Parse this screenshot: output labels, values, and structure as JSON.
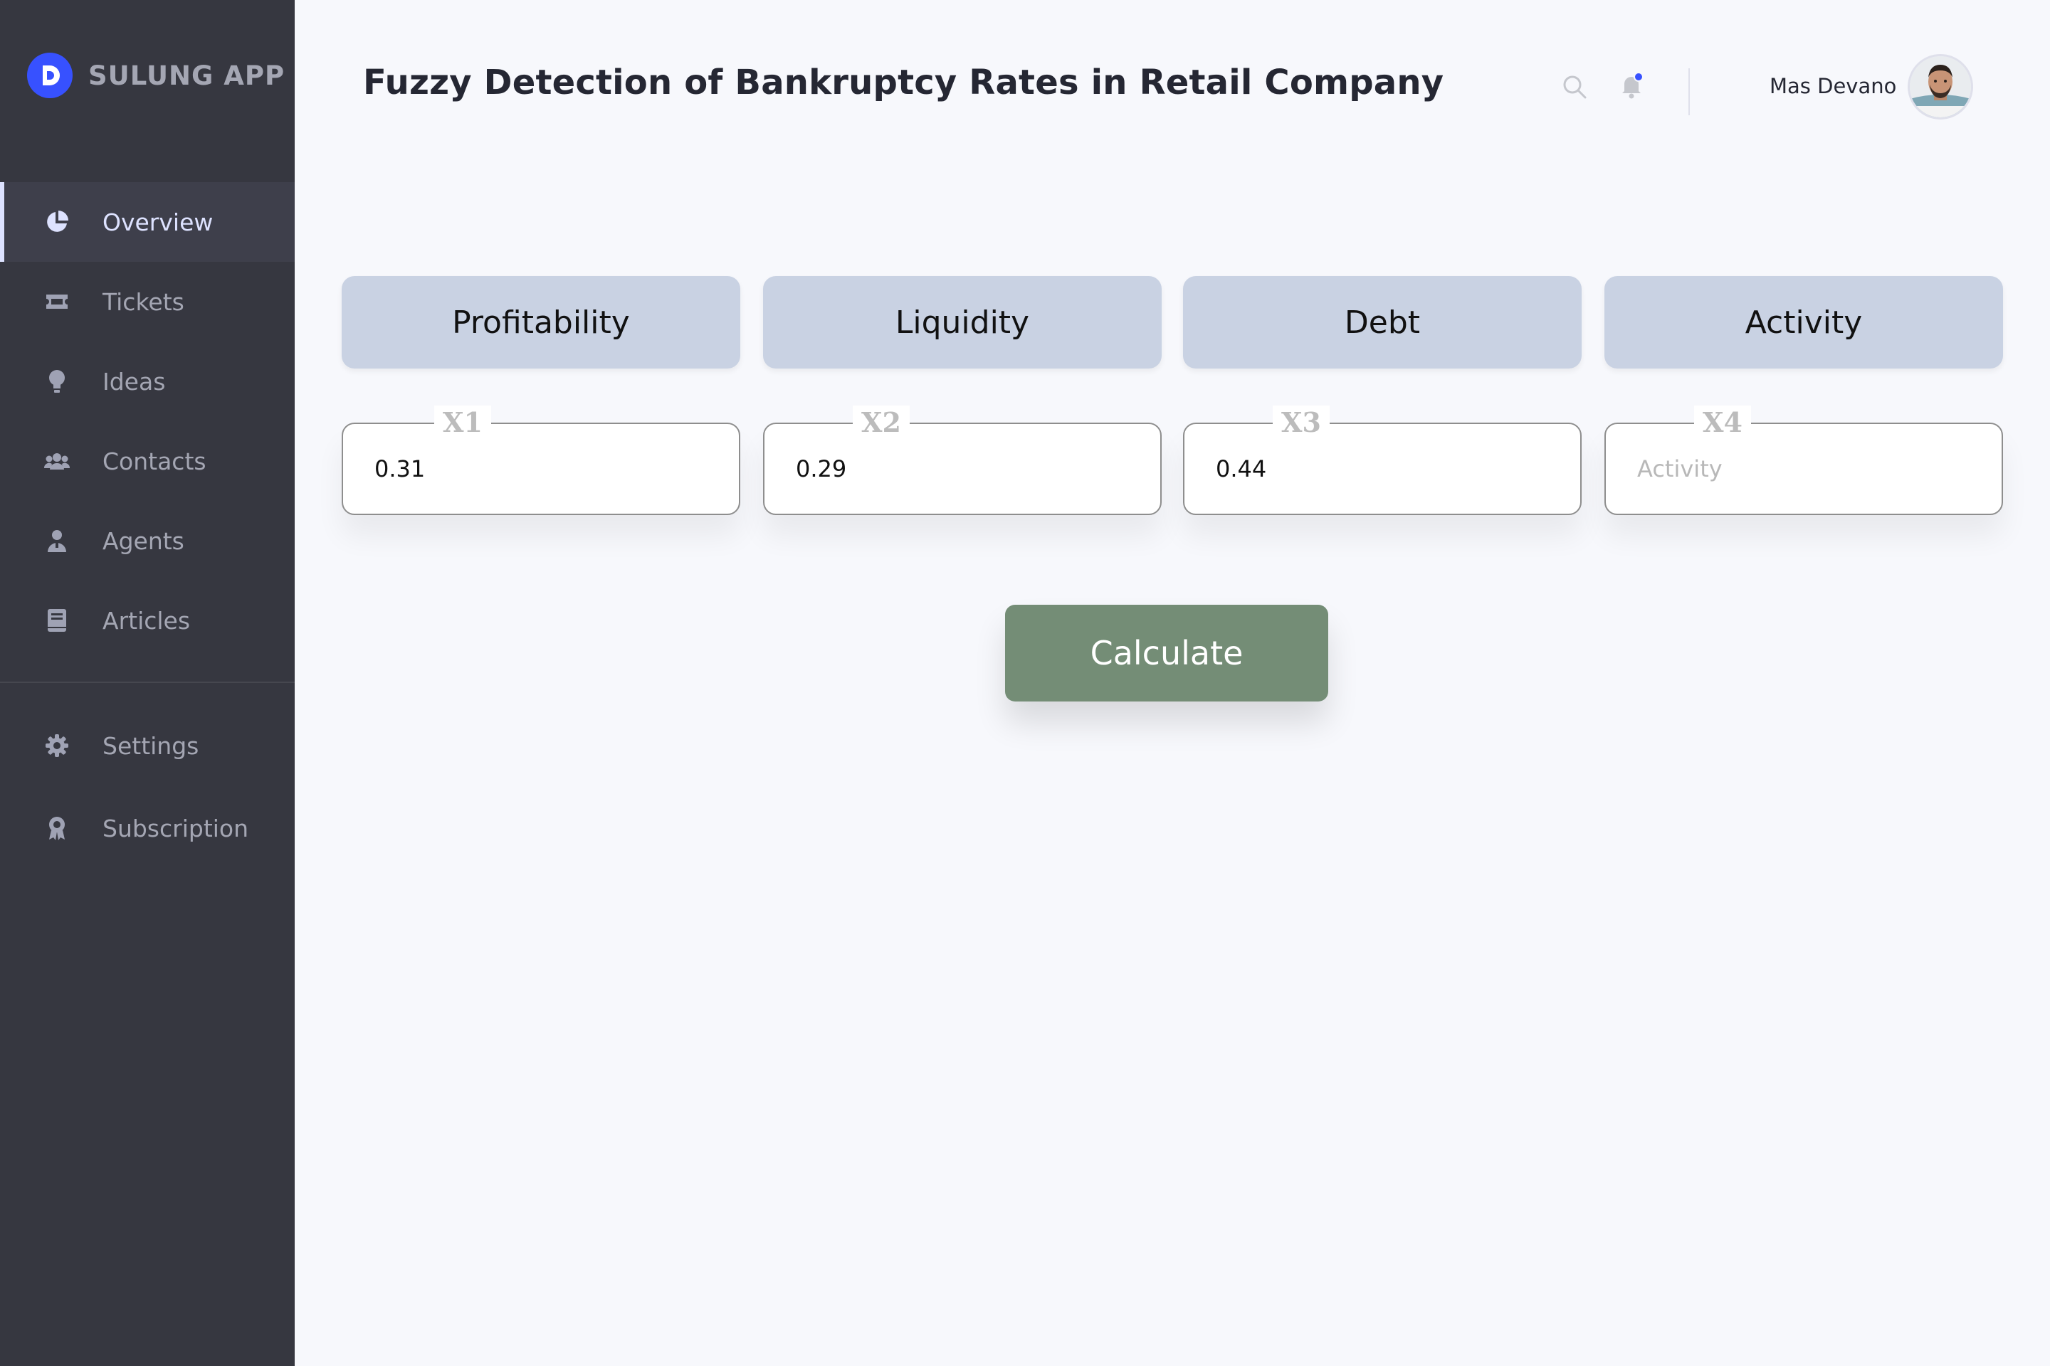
{
  "app": {
    "name": "SULUNG APP",
    "logo_letter": "D"
  },
  "sidebar": {
    "items": [
      {
        "label": "Overview",
        "icon": "pie-chart-icon",
        "active": true
      },
      {
        "label": "Tickets",
        "icon": "ticket-icon"
      },
      {
        "label": "Ideas",
        "icon": "lightbulb-icon"
      },
      {
        "label": "Contacts",
        "icon": "contacts-icon"
      },
      {
        "label": "Agents",
        "icon": "agent-icon"
      },
      {
        "label": "Articles",
        "icon": "book-icon"
      }
    ],
    "bottom_items": [
      {
        "label": "Settings",
        "icon": "gear-icon"
      },
      {
        "label": "Subscription",
        "icon": "award-icon"
      }
    ]
  },
  "header": {
    "title": "Fuzzy Detection of Bankruptcy Rates in Retail Company",
    "user_name": "Mas Devano",
    "notification_badge_color": "#3751ff"
  },
  "criteria": [
    {
      "label": "Profitability",
      "variable": "X1",
      "value": "0.31",
      "placeholder": ""
    },
    {
      "label": "Liquidity",
      "variable": "X2",
      "value": "0.29",
      "placeholder": ""
    },
    {
      "label": "Debt",
      "variable": "X3",
      "value": "0.44",
      "placeholder": ""
    },
    {
      "label": "Activity",
      "variable": "X4",
      "value": "",
      "placeholder": "Activity"
    }
  ],
  "actions": {
    "calculate_label": "Calculate"
  },
  "colors": {
    "sidebar_bg": "#363740",
    "accent": "#3751ff",
    "card_bg": "#c9d2e3",
    "button_bg": "#748d76",
    "page_bg": "#f7f8fc"
  }
}
